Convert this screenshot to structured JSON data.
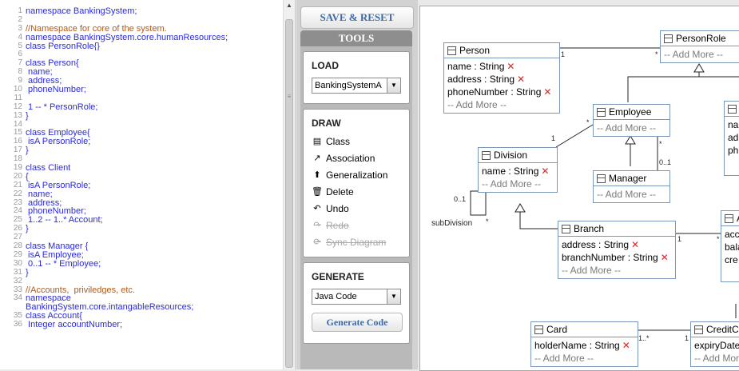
{
  "editor": {
    "lines": [
      {
        "n": "1",
        "text": "namespace BankingSystem;",
        "kind": "code"
      },
      {
        "n": "2",
        "text": "",
        "kind": "code"
      },
      {
        "n": "3",
        "text": "//Namespace for core of the system.",
        "kind": "comment"
      },
      {
        "n": "4",
        "text": "namespace BankingSystem.core.humanResources;",
        "kind": "code"
      },
      {
        "n": "5",
        "text": "class PersonRole{}",
        "kind": "code"
      },
      {
        "n": "6",
        "text": "",
        "kind": "code"
      },
      {
        "n": "7",
        "text": "class Person{",
        "kind": "code"
      },
      {
        "n": "8",
        "text": " name;",
        "kind": "code"
      },
      {
        "n": "9",
        "text": " address;",
        "kind": "code"
      },
      {
        "n": "10",
        "text": " phoneNumber;",
        "kind": "code"
      },
      {
        "n": "11",
        "text": "",
        "kind": "code"
      },
      {
        "n": "12",
        "text": " 1 -- * PersonRole;",
        "kind": "code"
      },
      {
        "n": "13",
        "text": "}",
        "kind": "code"
      },
      {
        "n": "14",
        "text": "",
        "kind": "code"
      },
      {
        "n": "15",
        "text": "class Employee{",
        "kind": "code"
      },
      {
        "n": "16",
        "text": " isA PersonRole;",
        "kind": "code"
      },
      {
        "n": "17",
        "text": "}",
        "kind": "code"
      },
      {
        "n": "18",
        "text": "",
        "kind": "code"
      },
      {
        "n": "19",
        "text": "class Client",
        "kind": "code"
      },
      {
        "n": "20",
        "text": "{",
        "kind": "code"
      },
      {
        "n": "21",
        "text": " isA PersonRole;",
        "kind": "code"
      },
      {
        "n": "22",
        "text": " name;",
        "kind": "code"
      },
      {
        "n": "23",
        "text": " address;",
        "kind": "code"
      },
      {
        "n": "24",
        "text": " phoneNumber;",
        "kind": "code"
      },
      {
        "n": "25",
        "text": " 1..2 -- 1..* Account;",
        "kind": "code"
      },
      {
        "n": "26",
        "text": "}",
        "kind": "code"
      },
      {
        "n": "27",
        "text": "",
        "kind": "code"
      },
      {
        "n": "28",
        "text": "class Manager {",
        "kind": "code"
      },
      {
        "n": "29",
        "text": " isA Employee;",
        "kind": "code"
      },
      {
        "n": "30",
        "text": " 0..1 -- * Employee;",
        "kind": "code"
      },
      {
        "n": "31",
        "text": "}",
        "kind": "code"
      },
      {
        "n": "32",
        "text": "",
        "kind": "code"
      },
      {
        "n": "33",
        "text": "//Accounts,  priviledges, etc.",
        "kind": "comment"
      },
      {
        "n": "34",
        "text": "namespace",
        "kind": "code"
      },
      {
        "n": "",
        "text": "BankingSystem.core.intangableResources;",
        "kind": "code"
      },
      {
        "n": "35",
        "text": "class Account{",
        "kind": "code"
      },
      {
        "n": "36",
        "text": " Integer accountNumber;",
        "kind": "code"
      }
    ]
  },
  "toolbar": {
    "save_reset_label": "SAVE & RESET",
    "tools_header": "TOOLS"
  },
  "load": {
    "heading": "LOAD",
    "selected": "BankingSystemA"
  },
  "draw": {
    "heading": "DRAW",
    "items": [
      {
        "label": "Class",
        "icon": "class-icon",
        "glyph": "▤",
        "enabled": true
      },
      {
        "label": "Association",
        "icon": "association-icon",
        "glyph": "↗",
        "enabled": true
      },
      {
        "label": "Generalization",
        "icon": "generalization-icon",
        "glyph": "⬆",
        "enabled": true
      },
      {
        "label": "Delete",
        "icon": "trash-icon",
        "glyph": "🗑",
        "enabled": true
      },
      {
        "label": "Undo",
        "icon": "undo-icon",
        "glyph": "↶",
        "enabled": true
      },
      {
        "label": "Redo",
        "icon": "redo-icon",
        "glyph": "↷",
        "enabled": false
      },
      {
        "label": "Sync Diagram",
        "icon": "sync-icon",
        "glyph": "⟳",
        "enabled": false
      }
    ]
  },
  "generate": {
    "heading": "GENERATE",
    "selected": "Java Code",
    "button_label": "Generate Code"
  },
  "diagram": {
    "add_more": "-- Add More --",
    "classes": {
      "person": {
        "name": "Person",
        "attrs": [
          "name : String",
          "address : String",
          "phoneNumber : String"
        ]
      },
      "person_role": {
        "name": "PersonRole",
        "attrs": []
      },
      "employee": {
        "name": "Employee",
        "attrs": []
      },
      "division": {
        "name": "Division",
        "attrs": [
          "name : String"
        ]
      },
      "manager": {
        "name": "Manager",
        "attrs": []
      },
      "branch": {
        "name": "Branch",
        "attrs": [
          "address : String",
          "branchNumber : String"
        ]
      },
      "card": {
        "name": "Card",
        "attrs": [
          "holderName : String"
        ]
      },
      "credit_card": {
        "name": "CreditCar",
        "attrs": [
          "expiryDate"
        ]
      },
      "client_partial": {
        "attrs": [
          "na",
          "ad",
          "ph"
        ]
      },
      "account_partial": {
        "name": "A",
        "attrs": [
          "acc",
          "bala",
          "cre"
        ]
      }
    },
    "multiplicities": {
      "person_role_1": "1",
      "person_role_many": "*",
      "emp_div_1": "1",
      "emp_div_many": "*",
      "mgr_many": "*",
      "mgr_01": "0..1",
      "sub_01": "0..1",
      "sub_many": "*",
      "sub_label": "subDivision",
      "branch_acc_1": "1",
      "branch_acc_many": "*",
      "card_cc_many": "1..*",
      "card_cc_1": "1"
    }
  },
  "colors": {
    "keyword": "#2a2adc",
    "comment": "#b05a1a",
    "button_text": "#3e6aa8",
    "delete_x": "#e0262a",
    "class_border": "#7a96b8"
  }
}
